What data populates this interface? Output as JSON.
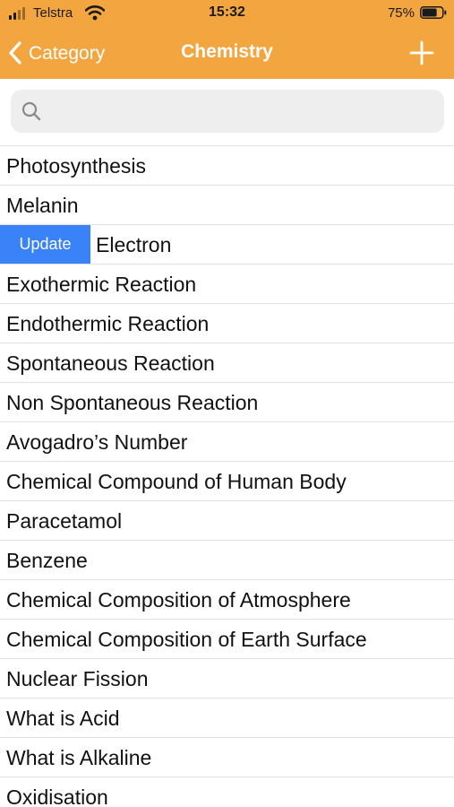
{
  "status_bar": {
    "carrier": "Telstra",
    "time": "15:32",
    "battery_percent": "75%",
    "battery_level": 0.75
  },
  "nav": {
    "back_label": "Category",
    "title": "Chemistry",
    "add_icon": "plus-icon",
    "back_icon": "chevron-left-icon"
  },
  "search": {
    "placeholder": "",
    "value": "",
    "icon": "search-icon"
  },
  "colors": {
    "header_bg": "#F3A640",
    "update_action_bg": "#3A82F7",
    "separator": "#E2E2E4",
    "search_bg": "#EEEEEF"
  },
  "swipe_action": {
    "label": "Update"
  },
  "items": [
    {
      "label": "Photosynthesis"
    },
    {
      "label": "Melanin"
    },
    {
      "label": "Electron"
    },
    {
      "label": "Exothermic Reaction"
    },
    {
      "label": "Endothermic Reaction"
    },
    {
      "label": "Spontaneous Reaction"
    },
    {
      "label": "Non Spontaneous Reaction"
    },
    {
      "label": "Avogadro’s Number"
    },
    {
      "label": "Chemical Compound of Human Body"
    },
    {
      "label": "Paracetamol"
    },
    {
      "label": "Benzene"
    },
    {
      "label": "Chemical Composition of Atmosphere"
    },
    {
      "label": "Chemical Composition of Earth Surface"
    },
    {
      "label": "Nuclear Fission"
    },
    {
      "label": "What is Acid"
    },
    {
      "label": "What is Alkaline"
    },
    {
      "label": "Oxidisation"
    }
  ]
}
